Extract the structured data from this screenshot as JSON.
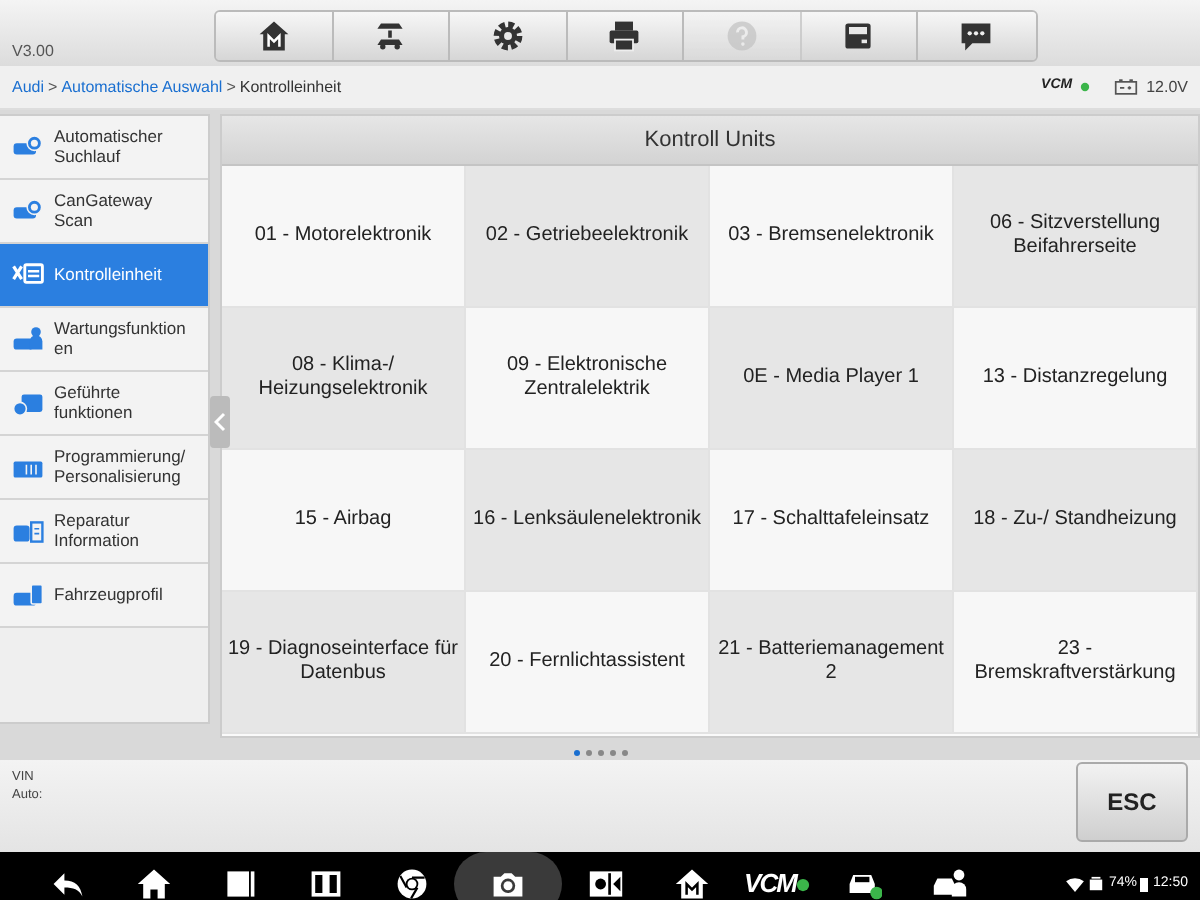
{
  "header": {
    "version": "V3.00"
  },
  "toolbar": [
    {
      "kind": "home",
      "disabled": false
    },
    {
      "kind": "lift",
      "disabled": false
    },
    {
      "kind": "settings",
      "disabled": false
    },
    {
      "kind": "print",
      "disabled": false
    },
    {
      "kind": "help",
      "disabled": true
    },
    {
      "kind": "save",
      "disabled": false
    },
    {
      "kind": "chat",
      "disabled": false
    }
  ],
  "breadcrumb": [
    {
      "kind": "link",
      "label": "Audi"
    },
    {
      "kind": "separator",
      "label": ">"
    },
    {
      "kind": "link",
      "label": "Automatische Auswahl"
    },
    {
      "kind": "separator",
      "label": ">"
    },
    {
      "kind": "current",
      "label": "Kontrolleinheit"
    }
  ],
  "status": {
    "vcm": "VCM",
    "voltage": "12.0V"
  },
  "sidebar": {
    "items": [
      {
        "label": "Automatischer Suchlauf",
        "selected": false
      },
      {
        "label": "CanGateway Scan",
        "selected": false
      },
      {
        "label": "Kontrolleinheit",
        "selected": true
      },
      {
        "label": "Wartungsfunktion en",
        "selected": false
      },
      {
        "label": "Geführte funktionen",
        "selected": false
      },
      {
        "label": "Programmierung/ Personalisierung",
        "selected": false
      },
      {
        "label": "Reparatur Information",
        "selected": false
      },
      {
        "label": "Fahrzeugprofil",
        "selected": false
      }
    ]
  },
  "panel": {
    "title": "Kontroll Units",
    "units": [
      "01 - Motorelektronik",
      "02 - Getriebeelektronik",
      "03 - Bremsenelektronik",
      "06 - Sitzverstellung Beifahrerseite",
      "08 - Klima-/ Heizungselektronik",
      "09 - Elektronische Zentralelektrik",
      "0E - Media Player 1",
      "13 - Distanzregelung",
      "15 - Airbag",
      "16 - Lenksäulenelektronik",
      "17 - Schalttafeleinsatz",
      "18 - Zu-/ Standheizung",
      "19 - Diagnoseinterface für Datenbus",
      "20 - Fernlichtassistent",
      "21 - Batteriemanagement 2",
      "23 - Bremskraftverstärkung"
    ],
    "pages": [
      {
        "selected": true
      },
      {
        "selected": false
      },
      {
        "selected": false
      },
      {
        "selected": false
      },
      {
        "selected": false
      }
    ]
  },
  "footer": {
    "vin_label": "VIN",
    "auto_label": "Auto:",
    "esc": "ESC"
  },
  "navbar": {
    "items": [
      {
        "kind": "back"
      },
      {
        "kind": "home"
      },
      {
        "kind": "window"
      },
      {
        "kind": "split"
      },
      {
        "kind": "browser"
      },
      {
        "kind": "camera"
      },
      {
        "kind": "display"
      },
      {
        "kind": "app"
      },
      {
        "kind": "vcm"
      },
      {
        "kind": "car"
      },
      {
        "kind": "service"
      }
    ],
    "vcm_text": "VCM",
    "battery": "74%",
    "time": "12:50"
  }
}
